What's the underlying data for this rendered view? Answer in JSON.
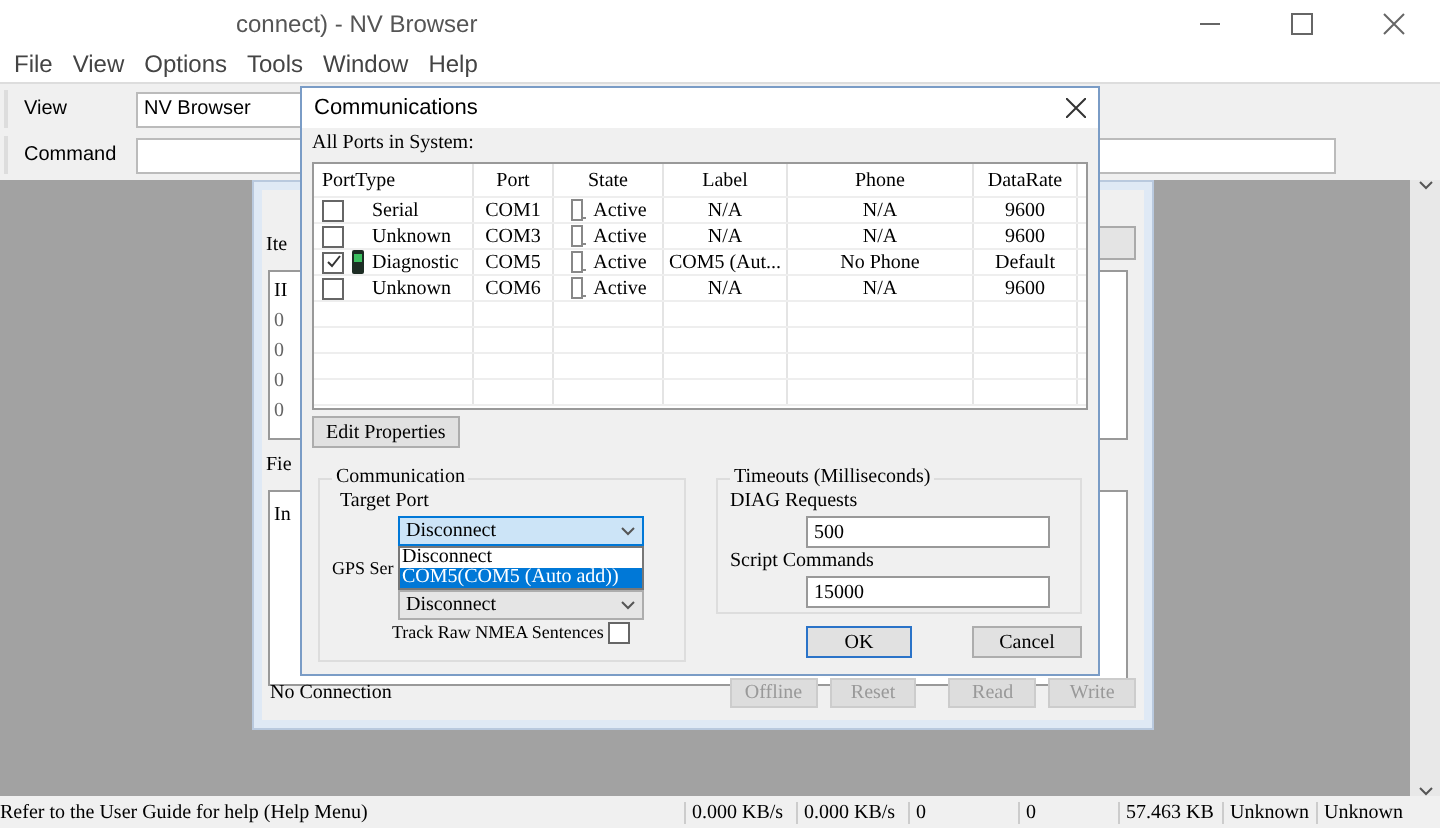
{
  "window": {
    "title": "connect) - NV Browser"
  },
  "menu": [
    "File",
    "View",
    "Options",
    "Tools",
    "Window",
    "Help"
  ],
  "toolbar": {
    "view_label": "View",
    "view_value": "NV Browser",
    "command_label": "Command"
  },
  "child_window": {
    "item_label": "Ite",
    "list_header": "II",
    "list_rows": [
      "0",
      "0",
      "0",
      "0"
    ],
    "field_label": "Fie",
    "field_header": "In",
    "status": "No Connection",
    "buttons": [
      {
        "label": "Offline",
        "disabled": true
      },
      {
        "label": "Reset",
        "disabled": true
      },
      {
        "label": "Read",
        "disabled": true
      },
      {
        "label": "Write",
        "disabled": true
      }
    ]
  },
  "dialog": {
    "title": "Communications",
    "ports_label": "All Ports in System:",
    "columns": [
      "PortType",
      "Port",
      "State",
      "Label",
      "Phone",
      "DataRate"
    ],
    "rows": [
      {
        "kind": "plain",
        "checked": false,
        "port_type": "Serial",
        "port": "COM1",
        "state": "Active",
        "label": "N/A",
        "phone": "N/A",
        "data_rate": "9600"
      },
      {
        "kind": "plain",
        "checked": false,
        "port_type": "Unknown",
        "port": "COM3",
        "state": "Active",
        "label": "N/A",
        "phone": "N/A",
        "data_rate": "9600"
      },
      {
        "kind": "diagnostic",
        "checked": true,
        "port_type": "Diagnostic",
        "port": "COM5",
        "state": "Active",
        "label": "COM5 (Aut...",
        "phone": "No Phone",
        "data_rate": "Default"
      },
      {
        "kind": "plain",
        "checked": false,
        "port_type": "Unknown",
        "port": "COM6",
        "state": "Active",
        "label": "N/A",
        "phone": "N/A",
        "data_rate": "9600"
      }
    ],
    "edit_button": "Edit Properties",
    "communication": {
      "legend": "Communication",
      "target_label": "Target Port",
      "target_value": "Disconnect",
      "open": true,
      "options": [
        {
          "label": "Disconnect",
          "selected": false
        },
        {
          "label": "COM5(COM5 (Auto add))",
          "selected": true
        }
      ],
      "gps_label": "GPS Ser",
      "gps_value": "Disconnect",
      "track_label": "Track Raw NMEA Sentences",
      "track_checked": false
    },
    "timeouts": {
      "legend": "Timeouts (Milliseconds)",
      "diag_label": "DIAG Requests",
      "diag_value": "500",
      "script_label": "Script Commands",
      "script_value": "15000"
    },
    "ok": "OK",
    "cancel": "Cancel"
  },
  "status_bar": {
    "message": "Refer to the User Guide for help (Help Menu)",
    "fields": [
      "0.000 KB/s",
      "0.000 KB/s",
      "0",
      "0",
      "57.463 KB",
      "Unknown",
      "Unknown"
    ]
  }
}
